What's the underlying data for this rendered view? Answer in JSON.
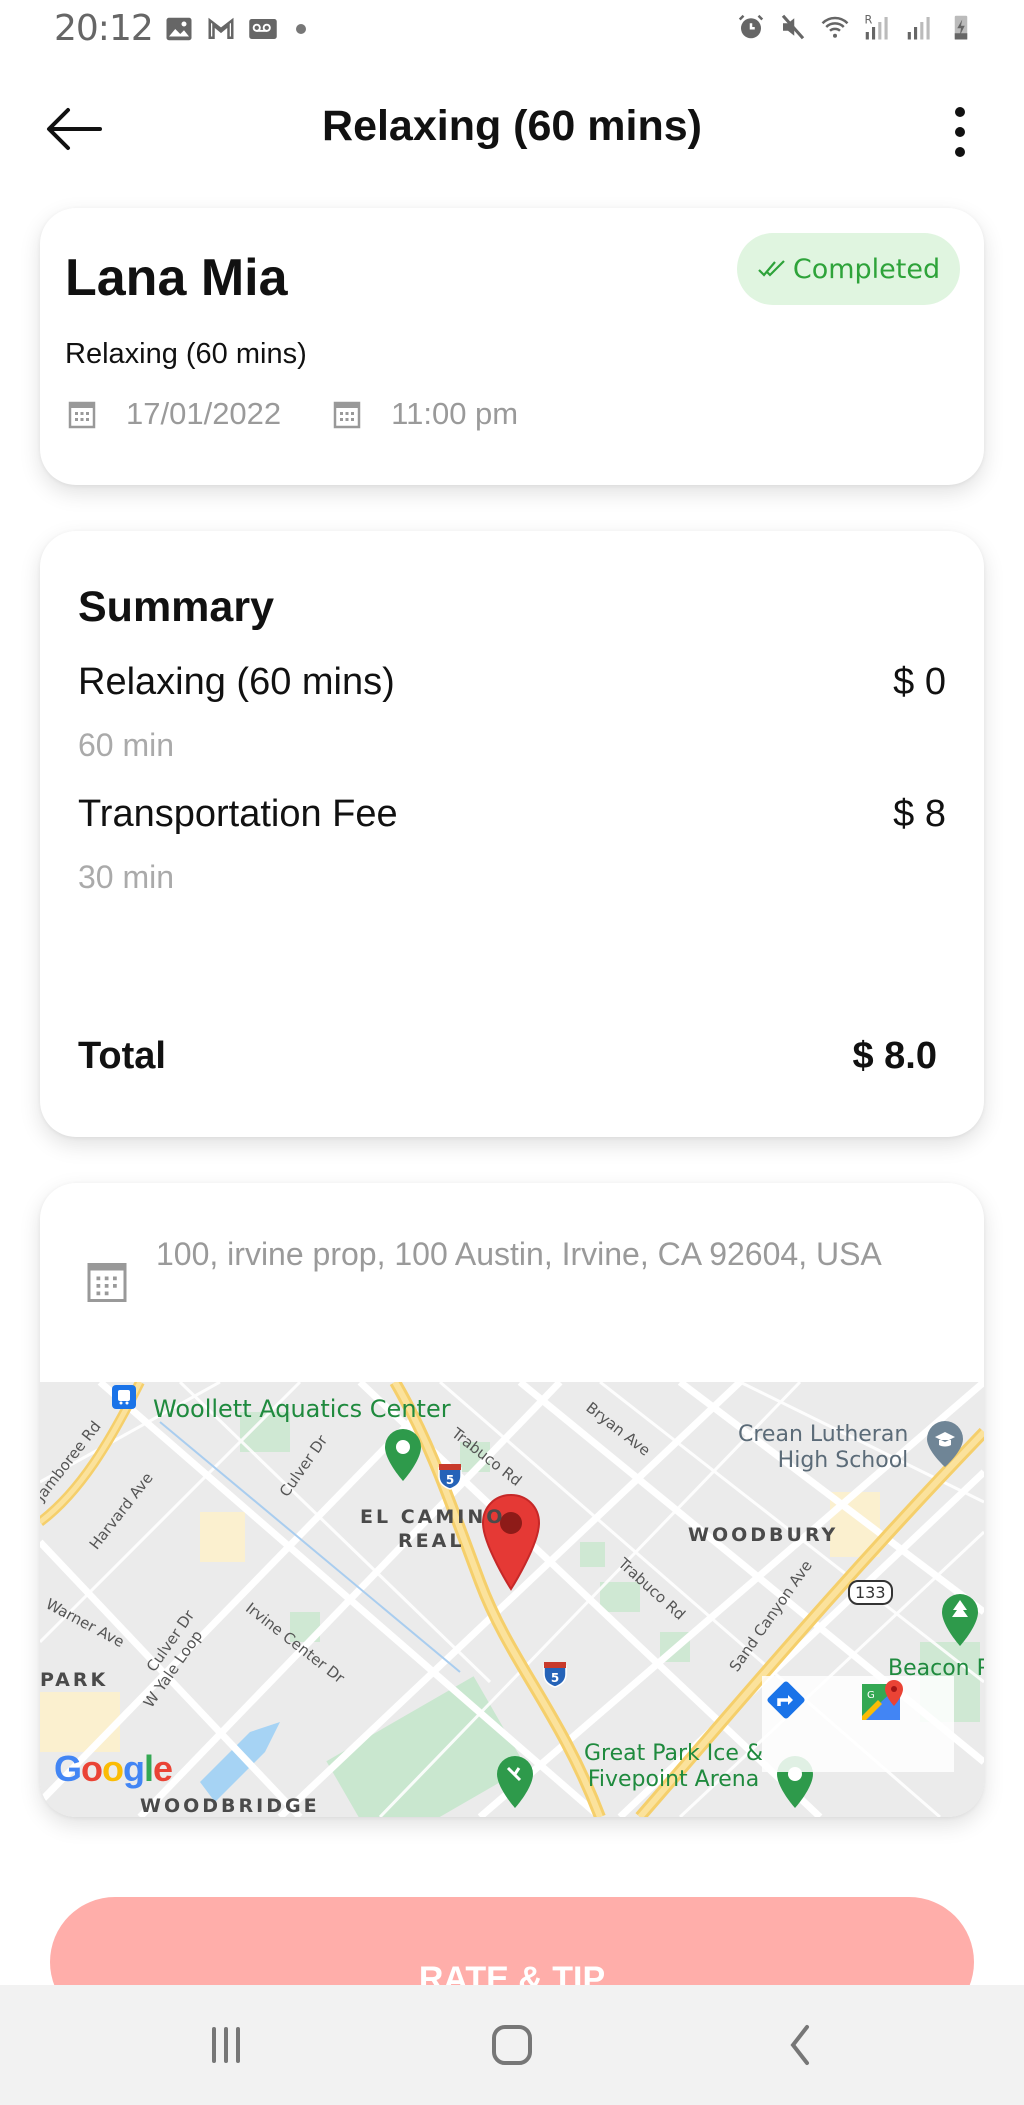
{
  "status_bar": {
    "time": "20:12",
    "left_icons": [
      "gallery-icon",
      "gmail-icon",
      "voicemail-icon",
      "dot-icon"
    ],
    "right_icons": [
      "alarm-icon",
      "mute-icon",
      "wifi-icon",
      "signal-roaming-icon",
      "signal-icon",
      "battery-charging-icon"
    ],
    "roaming_label": "R"
  },
  "app_bar": {
    "title": "Relaxing (60 mins)",
    "back_icon": "arrow-left-icon",
    "menu_icon": "more-vertical-icon"
  },
  "booking": {
    "client_name": "Lana Mia",
    "status": "Completed",
    "status_color": "#2ea33a",
    "status_bg": "#e0f5e0",
    "service": "Relaxing (60 mins)",
    "date": "17/01/2022",
    "time": "11:00 pm"
  },
  "summary": {
    "title": "Summary",
    "items": [
      {
        "name": "Relaxing (60 mins)",
        "price": "$ 0",
        "duration": "60 min"
      },
      {
        "name": "Transportation Fee",
        "price": "$ 8",
        "duration": "30 min"
      }
    ],
    "total_label": "Total",
    "total_value": "$ 8.0"
  },
  "location": {
    "address": "100, irvine prop, 100 Austin, Irvine, CA 92604, USA",
    "map": {
      "labels": {
        "woollett": "Woollett Aquatics Center",
        "el_camino": "EL CAMINO",
        "real": "REAL",
        "woodbury": "WOODBURY",
        "crean_1": "Crean Lutheran",
        "crean_2": "High School",
        "beacon": "Beacon Park",
        "great_park_1": "Great Park Ice &",
        "great_park_2": "Fivepoint Arena",
        "park": "PARK",
        "woodbridge": "WOODBRIDGE",
        "jamboree": "Jamboree Rd",
        "harvard": "Harvard Ave",
        "culver1": "Culver Dr",
        "culver2": "Culver Dr",
        "warner": "Warner Ave",
        "yale": "W Yale Loop",
        "irvine_center": "Irvine Center Dr",
        "trabuco1": "Trabuco Rd",
        "trabuco2": "Trabuco Rd",
        "bryan": "Bryan Ave",
        "sand_canyon": "Sand Canyon Ave",
        "route_133": "133",
        "i5": "5",
        "google": "Google"
      },
      "directions_button": "directions-icon",
      "open_maps_button": "google-maps-icon"
    }
  },
  "actions": {
    "rate_tip_label": "RATE & TIP",
    "rate_tip_color": "#ffaeaa"
  },
  "nav_bar": {
    "recents": "recents-icon",
    "home": "home-icon",
    "back": "back-icon"
  }
}
